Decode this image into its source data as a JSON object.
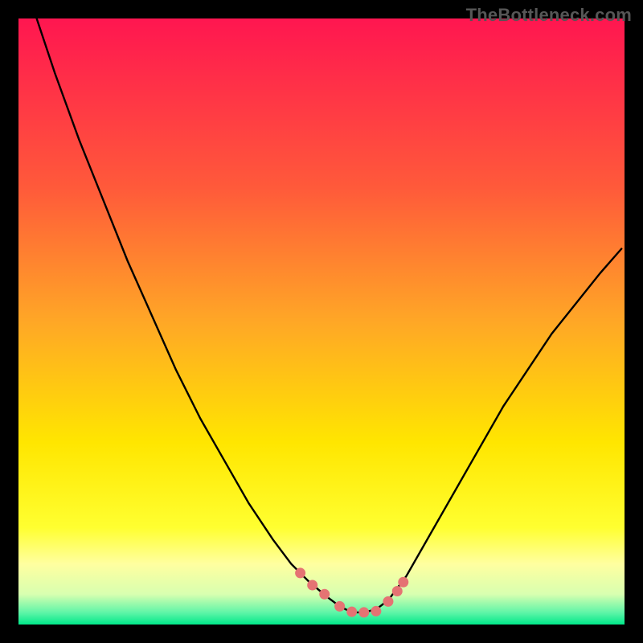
{
  "watermark": "TheBottleneck.com",
  "colors": {
    "frame": "#000000",
    "curve": "#000000",
    "marker_fill": "#e57373",
    "marker_stroke": "#e57373",
    "gradient_top": "#ff1650",
    "gradient_mid_upper": "#ff8a2a",
    "gradient_mid": "#ffe600",
    "gradient_lower": "#ffff8a",
    "gradient_bottom": "#00e88a"
  },
  "chart_data": {
    "type": "line",
    "title": "",
    "xlabel": "",
    "ylabel": "",
    "xlim": [
      0,
      100
    ],
    "ylim": [
      0,
      100
    ],
    "annotations": [],
    "series": [
      {
        "name": "curve",
        "x": [
          3,
          6,
          10,
          14,
          18,
          22,
          26,
          30,
          34,
          38,
          42,
          45,
          48,
          51,
          53,
          55,
          57,
          59,
          61,
          64,
          68,
          72,
          76,
          80,
          84,
          88,
          92,
          96,
          99.5
        ],
        "values": [
          100,
          91,
          80,
          70,
          60,
          51,
          42,
          34,
          27,
          20,
          14,
          10,
          7,
          4.5,
          3,
          2,
          2,
          2.5,
          4,
          8,
          15,
          22,
          29,
          36,
          42,
          48,
          53,
          58,
          62
        ]
      },
      {
        "name": "markers",
        "x": [
          46.5,
          48.5,
          50.5,
          53,
          55,
          57,
          59,
          61,
          62.5,
          63.5
        ],
        "values": [
          8.5,
          6.5,
          5,
          3,
          2.1,
          2,
          2.2,
          3.8,
          5.5,
          7
        ]
      }
    ]
  }
}
